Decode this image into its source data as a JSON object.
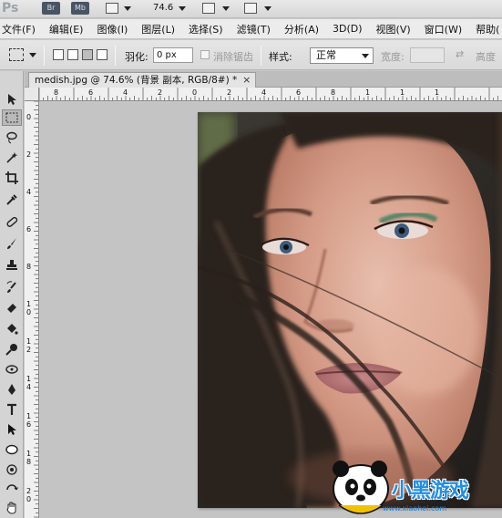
{
  "app": {
    "logo": "Ps",
    "bridge_label": "Br",
    "minibridge_label": "Mb",
    "zoom_value": "74.6"
  },
  "menu": {
    "items": [
      "文件(F)",
      "编辑(E)",
      "图像(I)",
      "图层(L)",
      "选择(S)",
      "滤镜(T)",
      "分析(A)",
      "3D(D)",
      "视图(V)",
      "窗口(W)",
      "帮助("
    ]
  },
  "options": {
    "feather_label": "羽化:",
    "feather_value": "0 px",
    "antialias_label": "消除锯齿",
    "style_label": "样式:",
    "style_value": "正常",
    "width_label": "宽度:",
    "height_label": "高度"
  },
  "document": {
    "tab_title": "medish.jpg @ 74.6% (背景 副本, RGB/8#) *",
    "close": "×"
  },
  "ruler": {
    "h_labels": [
      "8",
      "6",
      "4",
      "2",
      "0",
      "2",
      "4",
      "6",
      "8",
      "1",
      "1",
      "1"
    ],
    "v_labels": [
      "0",
      "2",
      "4",
      "6",
      "8",
      "1 0",
      "1 2",
      "1 4",
      "1 6",
      "1 8",
      "2 0"
    ]
  },
  "watermark": {
    "text": "小黑游戏",
    "url": "www.xiaohei.com"
  },
  "colors": {
    "accent_blue": "#1f8ee8",
    "chrome_gray": "#d4d4d4",
    "canvas_gray": "#c4c4c4"
  }
}
